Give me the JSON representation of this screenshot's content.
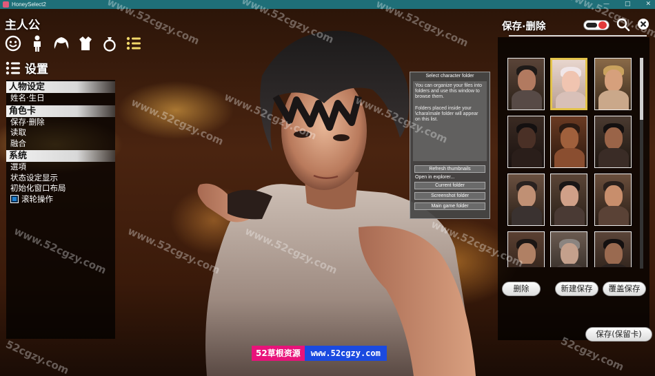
{
  "window": {
    "title": "HoneySelect2",
    "controls": [
      "—",
      "□",
      "✕"
    ]
  },
  "left": {
    "top_label": "主人公",
    "category_icons": [
      "face-icon",
      "body-icon",
      "hair-icon",
      "clothes-icon",
      "accessory-ring-icon",
      "list-icon"
    ],
    "settings_label": "设置",
    "sections": [
      {
        "header": "人物设定",
        "items": [
          "姓名·生日"
        ]
      },
      {
        "header": "角色卡",
        "items": [
          "保存·删除",
          "读取",
          "融合"
        ]
      },
      {
        "header": "系统",
        "items": [
          "選項",
          "状态设定显示",
          "初始化窗口布局"
        ]
      }
    ],
    "wheel_label": "滚轮操作",
    "wheel_checked": true
  },
  "folder_popup": {
    "title": "Select character folder",
    "desc_p1": "You can organize your files into folders and use this window to browse them.",
    "desc_p2": "Folders placed inside your \\chara\\male folder will appear on this list.",
    "refresh": "Refresh thumbnails",
    "open_in": "Open in explorer...",
    "current": "Current folder",
    "screenshot": "Screenshot folder",
    "main_game": "Main game folder"
  },
  "right": {
    "title": "保存·删除",
    "thumbnails_count_visible": 12,
    "selected_index": 1,
    "delete": "删除",
    "new_save": "新建保存",
    "overwrite": "覆盖保存",
    "save_keep_card": "保存(保留卡)"
  },
  "watermark": {
    "text": "www.52cgzy.com",
    "text_short": "52cgzy.com",
    "banner_cn": "52草根资源",
    "banner_url": "www.52cgzy.com"
  },
  "colors": {
    "titlebar": "#1f6f78",
    "selected_border": "#e3c34a",
    "checkbox": "#1d7fd0",
    "banner_pink": "#e8137a",
    "banner_blue": "#1a4ae0"
  }
}
